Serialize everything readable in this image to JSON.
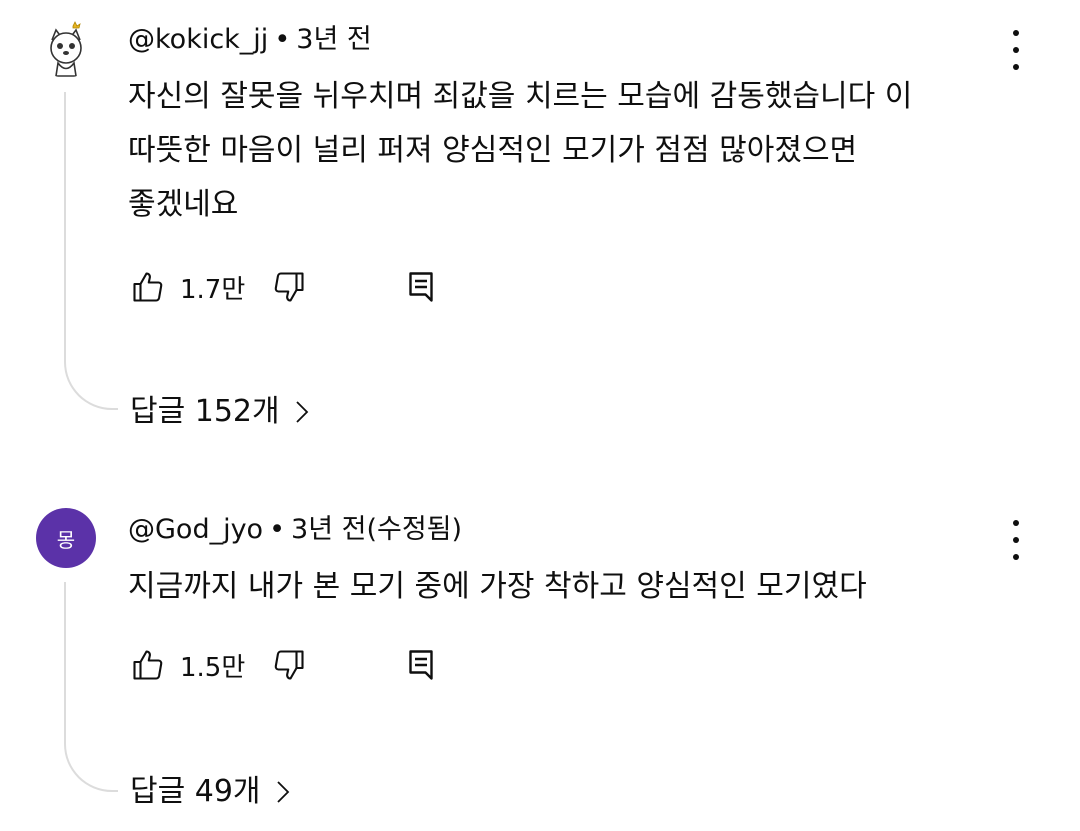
{
  "comments": [
    {
      "handle": "@kokick_jj",
      "separator": "•",
      "time": "3년 전",
      "body_lines": [
        "자신의 잘못을 뉘우치며 죄값을 치르는 모습에 감동했습니다 이",
        "따뜻한 마음이 널리 퍼져 양심적인 모기가 점점 많아졌으면",
        "좋겠네요"
      ],
      "like_count": "1.7만",
      "replies_label": "답글 152개",
      "avatar_icon": "cartoon-cat-icon"
    },
    {
      "handle": "@God_jyo",
      "separator": "•",
      "time": "3년 전(수정됨)",
      "body_lines": [
        "지금까지 내가 본 모기 중에 가장 착하고 양심적인 모기였다"
      ],
      "like_count": "1.5만",
      "replies_label": "답글 49개",
      "avatar_letter": "몽",
      "avatar_color": "#5b32a8"
    }
  ],
  "icons": {
    "like": "thumbs-up-icon",
    "dislike": "thumbs-down-icon",
    "reply": "comment-icon",
    "more": "more-vertical-icon",
    "chevron": "chevron-right-icon"
  },
  "colors": {
    "text": "#0f0f0f",
    "thread_line": "#dcdcdc"
  }
}
